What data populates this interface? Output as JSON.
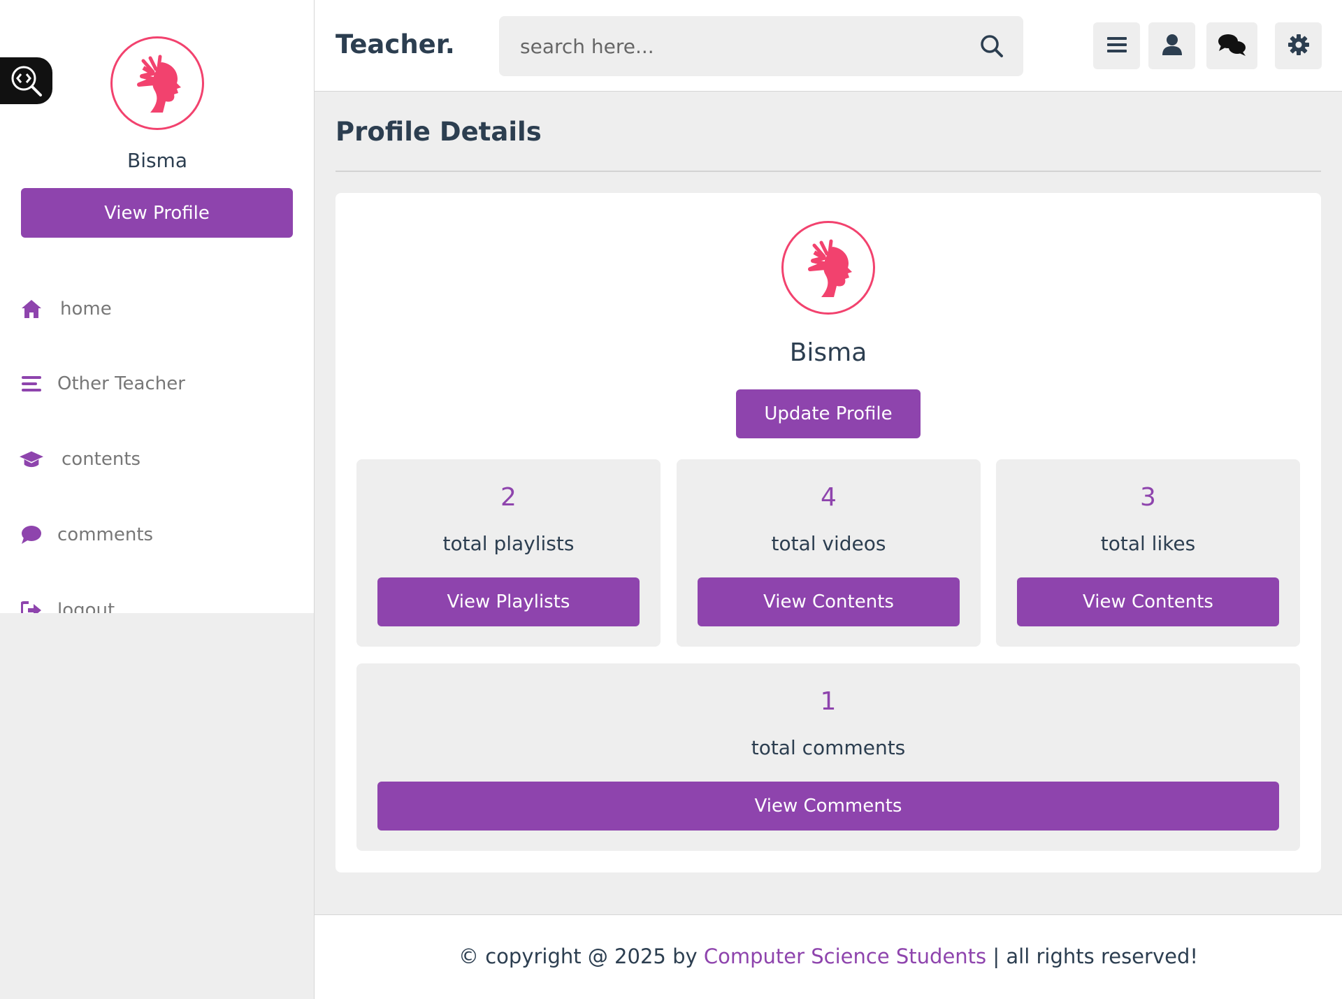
{
  "app": {
    "logo": "Teacher."
  },
  "search": {
    "placeholder": "search here..."
  },
  "sidebar": {
    "user_name": "Bisma",
    "view_profile_label": "View Profile",
    "items": [
      {
        "label": "home",
        "icon": "home-icon"
      },
      {
        "label": "Other Teacher",
        "icon": "bars-icon"
      },
      {
        "label": "contents",
        "icon": "graduation-cap-icon"
      },
      {
        "label": "comments",
        "icon": "comment-icon"
      },
      {
        "label": "logout",
        "icon": "logout-icon"
      }
    ]
  },
  "header": {
    "buttons": [
      "menu-icon",
      "user-icon",
      "chat-icon",
      "settings-icon"
    ]
  },
  "main": {
    "title": "Profile Details",
    "user_name": "Bisma",
    "update_label": "Update Profile",
    "stats": [
      {
        "value": "2",
        "label": "total playlists",
        "button": "View Playlists"
      },
      {
        "value": "4",
        "label": "total videos",
        "button": "View Contents"
      },
      {
        "value": "3",
        "label": "total likes",
        "button": "View Contents"
      },
      {
        "value": "1",
        "label": "total comments",
        "button": "View Comments"
      }
    ]
  },
  "footer": {
    "prefix": "© copyright @ 2025 by ",
    "link": "Computer Science Students",
    "suffix": " | all rights reserved!"
  },
  "colors": {
    "accent": "#8e44ad",
    "background": "#eeeeee",
    "text": "#2c3e50",
    "avatar_pink": "#f2426e"
  }
}
